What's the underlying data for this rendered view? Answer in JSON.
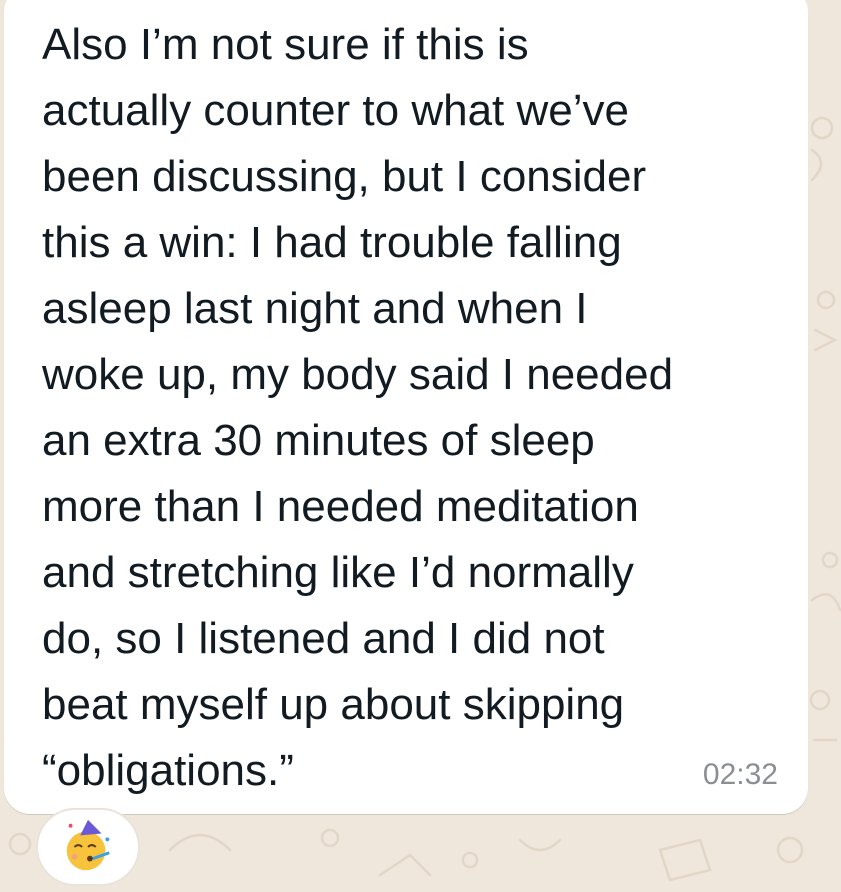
{
  "message": {
    "text": "Also I’m not sure if this is\nactually counter to what we’ve\nbeen discussing, but I consider\nthis a win: I had trouble falling\nasleep last night and when I\nwoke up, my body said I needed\nan extra 30 minutes of sleep\nmore than I needed meditation\nand stretching like I’d normally\ndo, so I listened and I did not\nbeat myself up about skipping\n“obligations.”",
    "time": "02:32"
  },
  "reaction": {
    "icon": "party-face-icon"
  },
  "colors": {
    "wallpaper": "#efe7dc",
    "bubble": "#ffffff",
    "text": "#111b21",
    "timestamp": "#8a8f93"
  }
}
